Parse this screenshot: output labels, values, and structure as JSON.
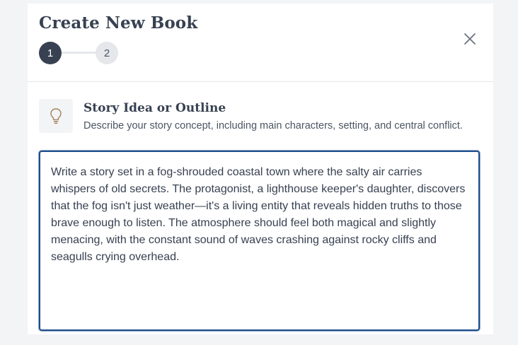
{
  "modal": {
    "title": "Create New Book",
    "close_icon": "close-icon",
    "steps": [
      {
        "label": "1",
        "state": "active"
      },
      {
        "label": "2",
        "state": "inactive"
      }
    ]
  },
  "section": {
    "icon": "lightbulb-icon",
    "title": "Story Idea or Outline",
    "description": "Describe your story concept, including main characters, setting, and central conflict."
  },
  "story_input": {
    "value": "Write a story set in a fog-shrouded coastal town where the salty air carries whispers of old secrets. The protagonist, a lighthouse keeper's daughter, discovers that the fog isn't just weather—it's a living entity that reveals hidden truths to those brave enough to listen. The atmosphere should feel both magical and slightly menacing, with the constant sound of waves crashing against rocky cliffs and seagulls crying overhead."
  },
  "colors": {
    "step_active": "#374151",
    "step_inactive": "#e5e7eb",
    "focus_border": "#1e4e8c",
    "icon_accent": "#a08060"
  }
}
